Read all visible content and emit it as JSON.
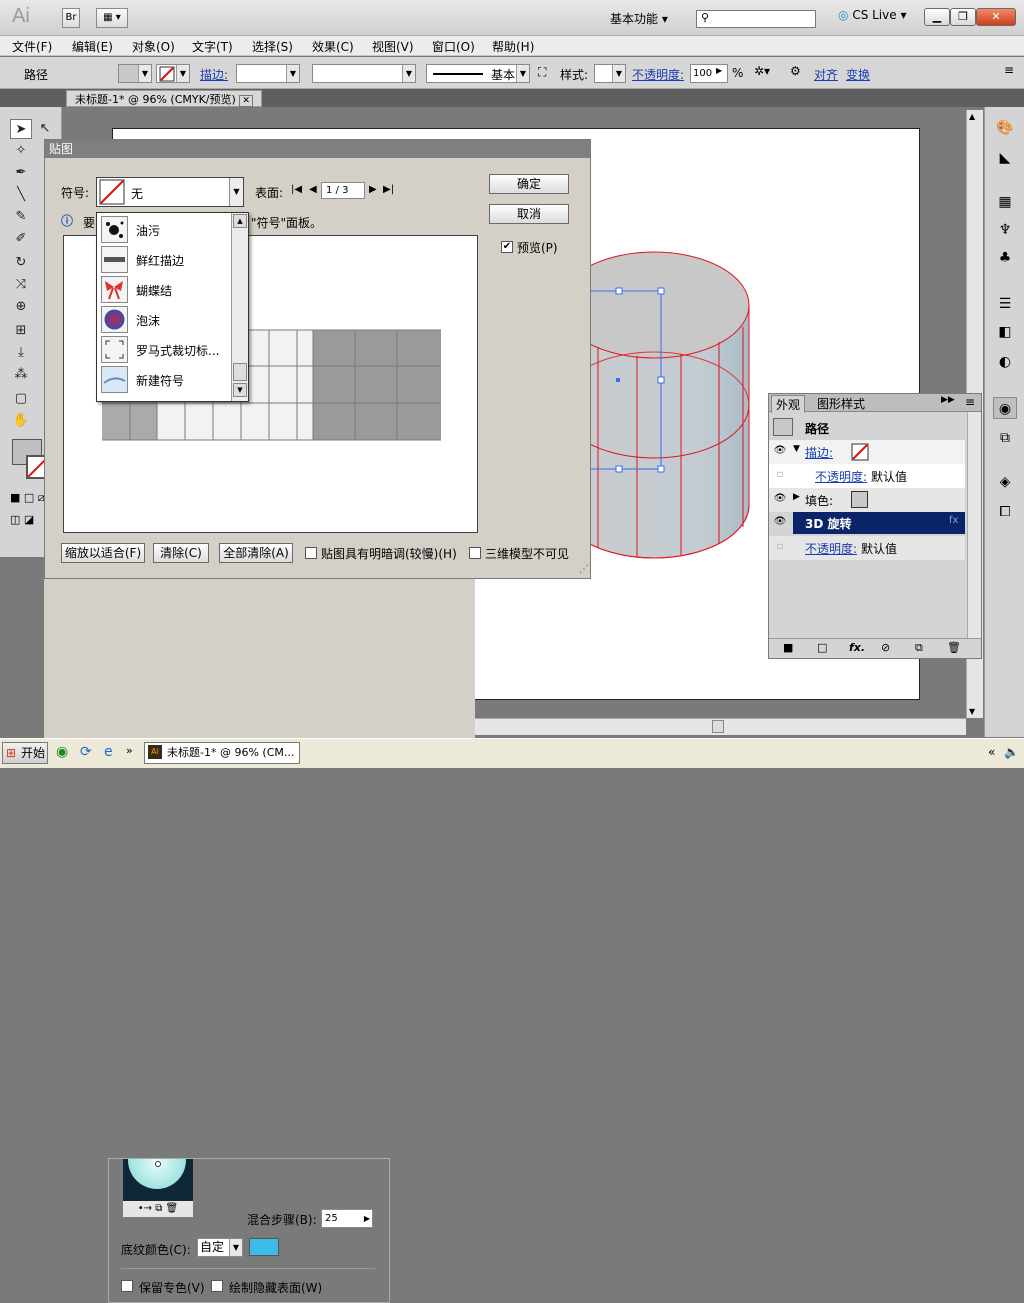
{
  "titlebar": {
    "app_logo": "Ai",
    "bridge_button": "Br",
    "workspace": "基本功能",
    "cs_live": "CS Live"
  },
  "menu": [
    "文件(F)",
    "编辑(E)",
    "对象(O)",
    "文字(T)",
    "选择(S)",
    "效果(C)",
    "视图(V)",
    "窗口(O)",
    "帮助(H)"
  ],
  "control_bar": {
    "selection_label": "路径",
    "stroke_label": "描边:",
    "brush_label": "基本",
    "style_label": "样式:",
    "opacity_label": "不透明度:",
    "opacity_value": "100",
    "opacity_unit": "%",
    "align_link": "对齐",
    "transform_link": "变换"
  },
  "document_tab": "未标题-1* @ 96% (CMYK/预览)",
  "dialog": {
    "title": "贴图",
    "symbol_label": "符号:",
    "symbol_value": "无",
    "surface_label": "表面:",
    "surface_value": "1 / 3",
    "hint_prefix": "要",
    "hint_suffix": "\"符号\"面板。",
    "ok_button": "确定",
    "cancel_button": "取消",
    "preview_label": "预览(P)",
    "scale_to_fit": "缩放以适合(F)",
    "clear": "清除(C)",
    "clear_all": "全部清除(A)",
    "shade_artwork": "贴图具有明暗调(较慢)(H)",
    "invisible_geometry": "三维模型不可见",
    "symbols": [
      "油污",
      "鲜红描边",
      "蝴蝶结",
      "泡沫",
      "罗马式裁切标...",
      "新建符号"
    ]
  },
  "under_panel": {
    "blend_steps_label": "混合步骤(B):",
    "blend_steps_value": "25",
    "shading_color_label": "底纹颜色(C):",
    "shading_color_value": "自定",
    "preserve_spot": "保留专色(V)",
    "draw_hidden": "绘制隐藏表面(W)"
  },
  "appearance": {
    "tabs": [
      "外观",
      "图形样式"
    ],
    "header": "路径",
    "rows": [
      {
        "label": "描边:",
        "kind": "stroke"
      },
      {
        "label": "不透明度:",
        "value": "默认值",
        "kind": "sub"
      },
      {
        "label": "填色:",
        "kind": "fill"
      },
      {
        "label": "3D 旋转",
        "kind": "effect"
      },
      {
        "label": "不透明度:",
        "value": "默认值",
        "kind": "opacity"
      }
    ]
  },
  "taskbar": {
    "start": "开始",
    "active_item": "未标题-1* @ 96% (CM..."
  },
  "colors": {
    "accent_blue": "#0a246a",
    "cylinder_fill": "#c8ccd0",
    "cylinder_stroke": "#e0141e",
    "shading_swatch": "#3bbde8"
  }
}
